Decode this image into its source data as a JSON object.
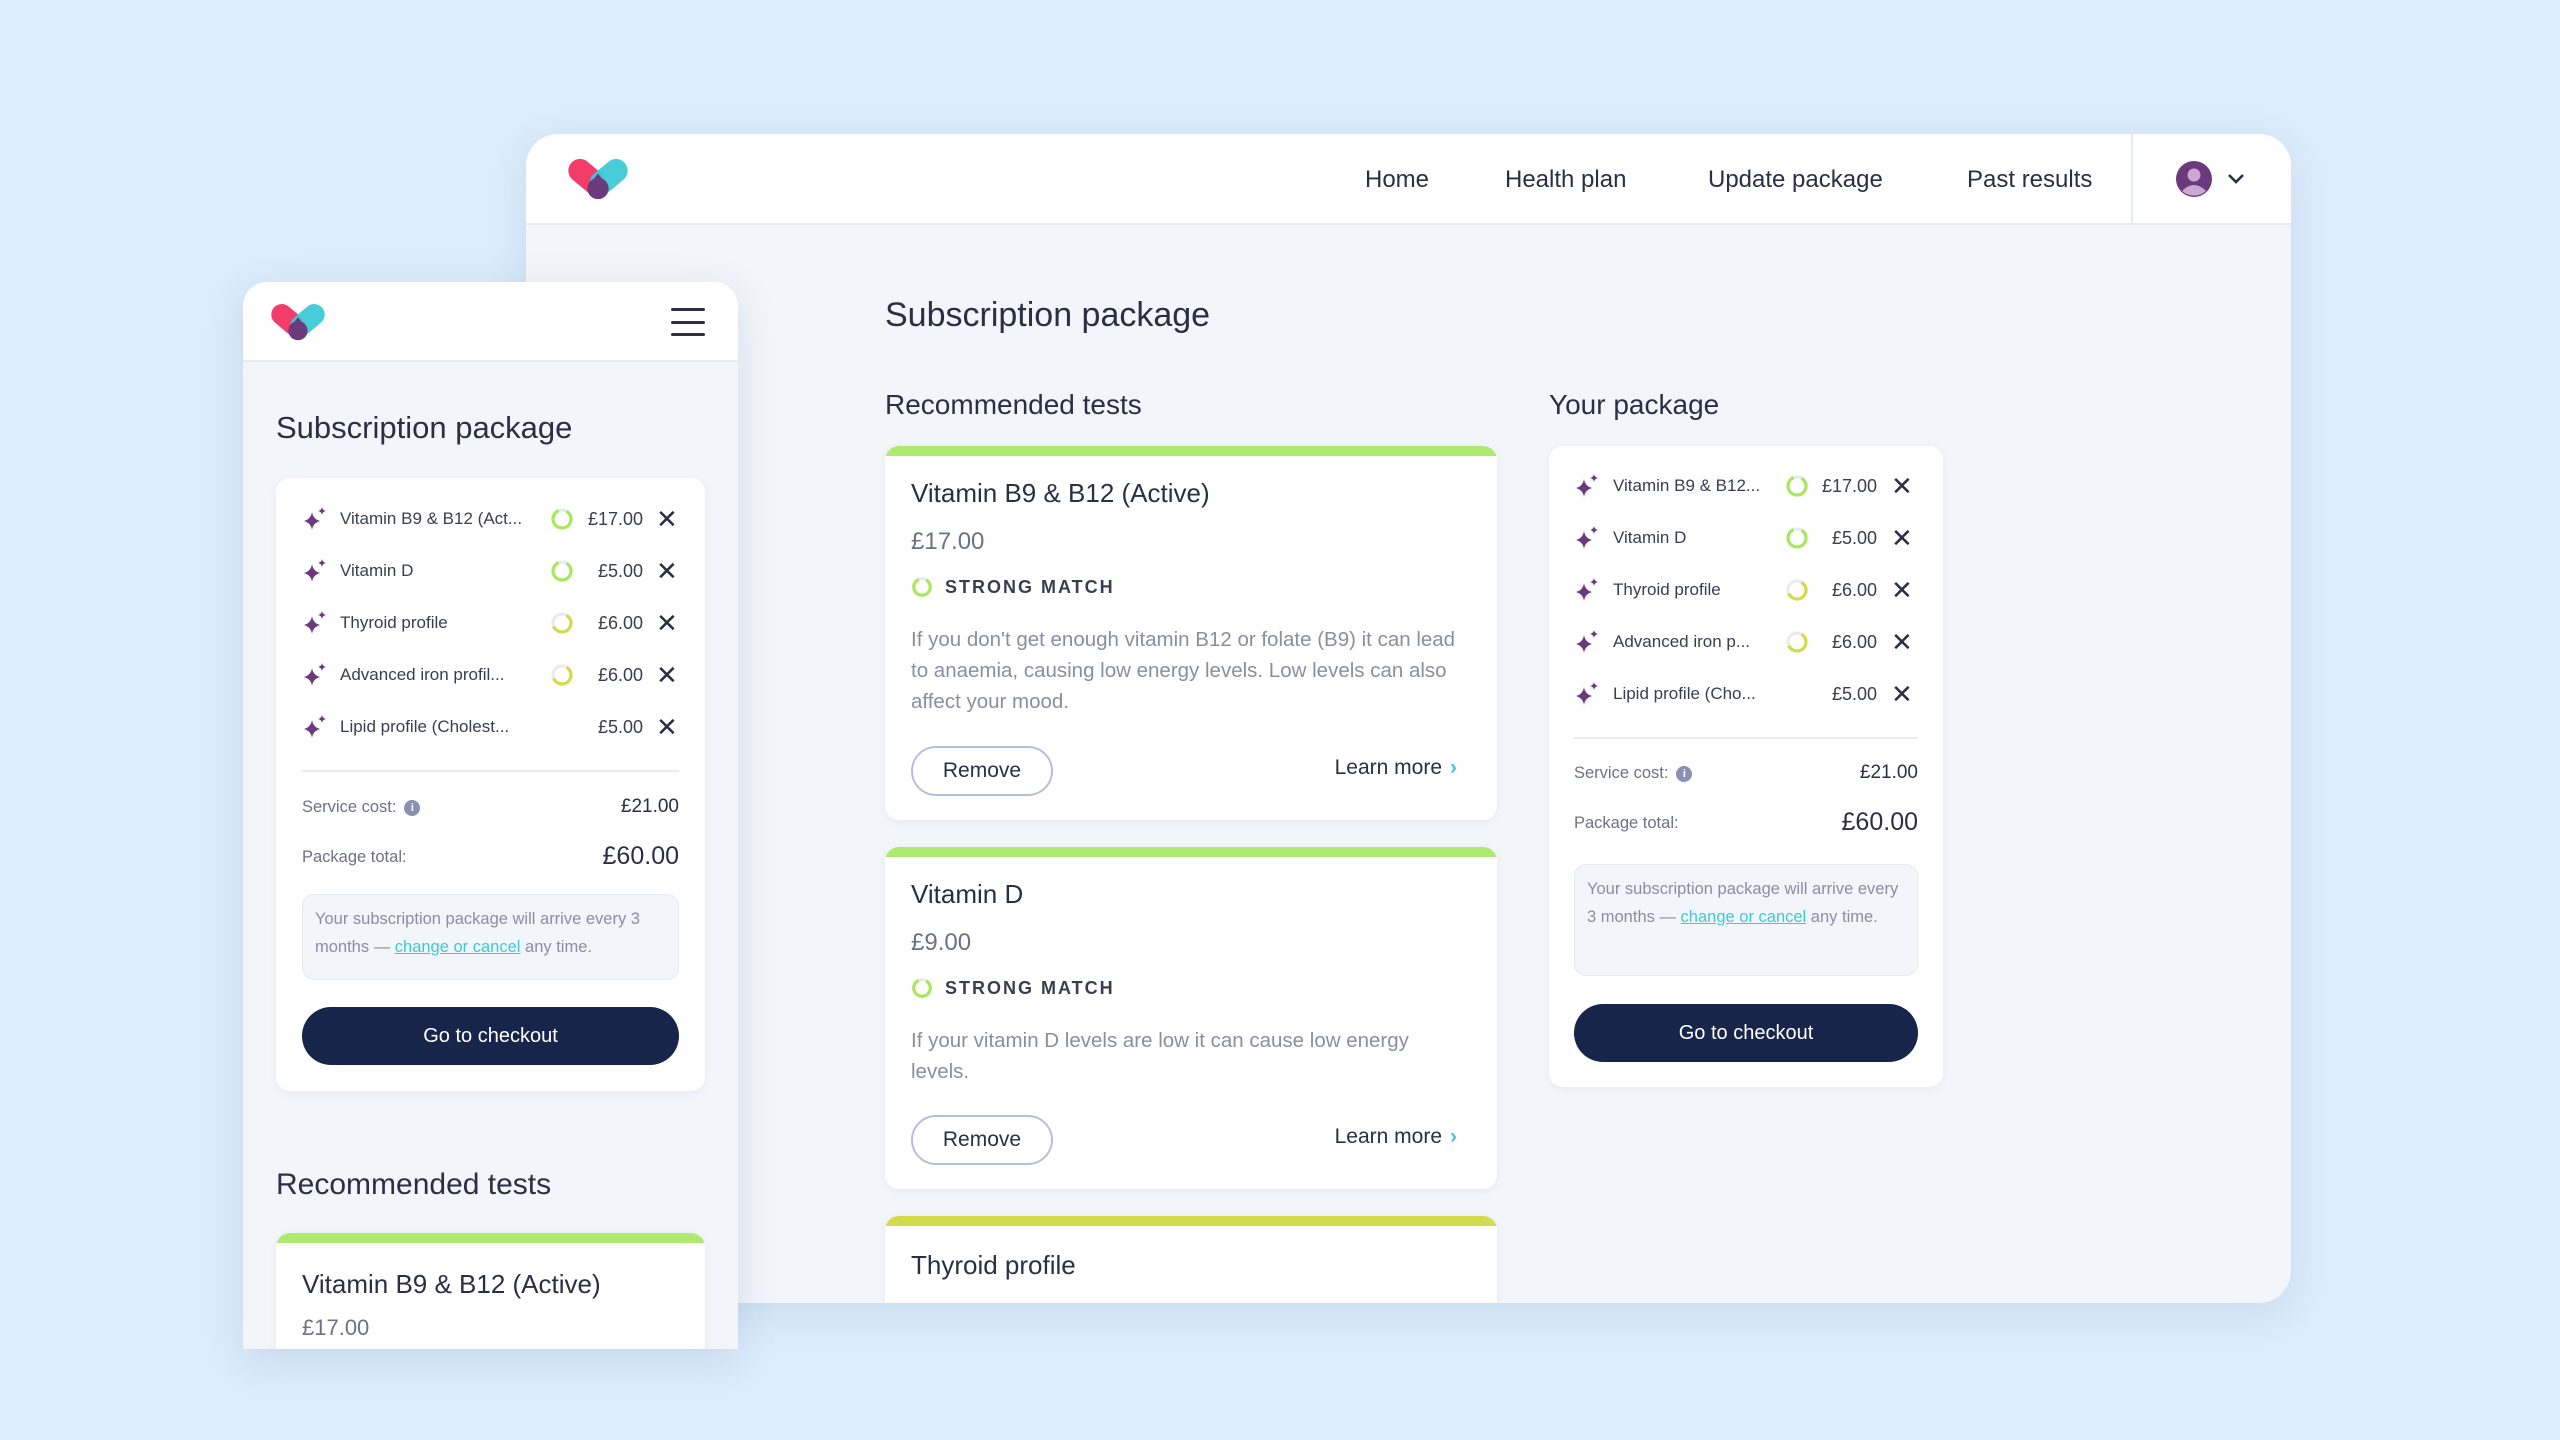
{
  "colors": {
    "brand_pink": "#f23c6a",
    "brand_teal": "#3ec9d6",
    "brand_purple": "#6b3a7d",
    "strong_match": "#a8e85c",
    "medium_match": "#d2dc4a",
    "navy": "#18254a"
  },
  "nav": {
    "items": [
      "Home",
      "Health plan",
      "Update package",
      "Past results"
    ],
    "avatar_icon": "user-avatar-icon",
    "chevron_icon": "chevron-down-icon"
  },
  "page_title": "Subscription package",
  "recommended": {
    "heading": "Recommended tests",
    "cards": [
      {
        "title": "Vitamin B9 & B12 (Active)",
        "price": "£17.00",
        "match": "STRONG MATCH",
        "description": "If you don't get enough vitamin B12 or folate (B9) it can lead to anaemia, causing low energy levels. Low levels can also affect your mood.",
        "remove": "Remove",
        "learn_more": "Learn more"
      },
      {
        "title": "Vitamin D",
        "price": "£9.00",
        "match": "STRONG MATCH",
        "description": "If your vitamin D levels are low it can cause low energy levels.",
        "remove": "Remove",
        "learn_more": "Learn more"
      },
      {
        "title": "Thyroid profile"
      }
    ]
  },
  "package": {
    "heading": "Your package",
    "items": [
      {
        "name": "Vitamin B9 & B12...",
        "mobile_name": "Vitamin B9 & B12 (Act...",
        "price": "£17.00",
        "match": "strong",
        "match_level": 0.85
      },
      {
        "name": "Vitamin D",
        "mobile_name": "Vitamin D",
        "price": "£5.00",
        "match": "strong",
        "match_level": 0.85
      },
      {
        "name": "Thyroid profile",
        "mobile_name": "Thyroid profile",
        "price": "£6.00",
        "match": "medium",
        "match_level": 0.6
      },
      {
        "name": "Advanced iron p...",
        "mobile_name": "Advanced iron profil...",
        "price": "£6.00",
        "match": "medium",
        "match_level": 0.6
      },
      {
        "name": "Lipid profile (Cho...",
        "mobile_name": "Lipid profile (Cholest...",
        "price": "£5.00",
        "match": "none",
        "match_level": 0
      }
    ],
    "service_cost_label": "Service cost:",
    "service_cost": "£21.00",
    "total_label": "Package total:",
    "total": "£60.00",
    "note_before": "Your subscription package will arrive every 3 months — ",
    "note_link": "change or cancel",
    "note_after": " any time.",
    "checkout": "Go to checkout"
  },
  "mobile": {
    "title": "Subscription package",
    "recommended_heading": "Recommended tests",
    "card_title": "Vitamin B9 & B12 (Active)",
    "card_price": "£17.00"
  }
}
